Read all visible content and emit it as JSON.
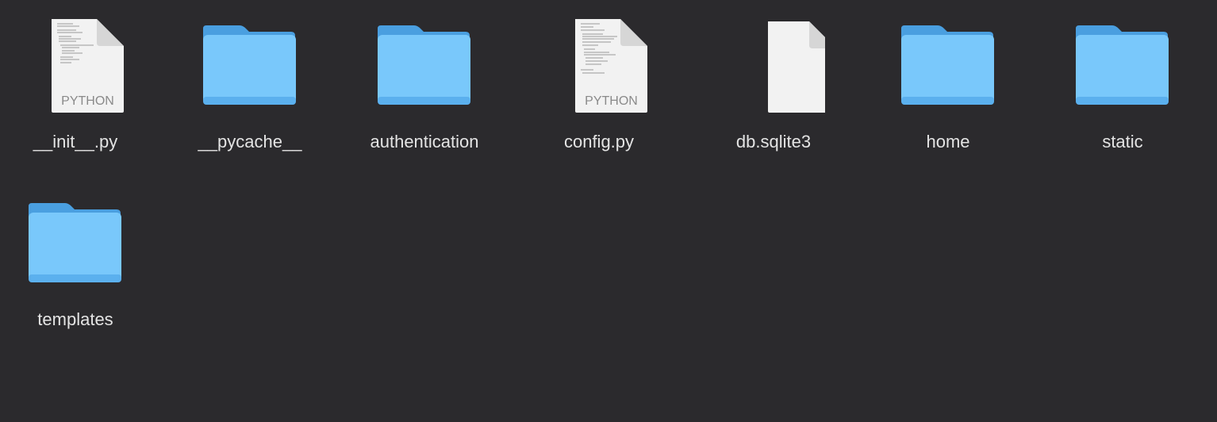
{
  "finder": {
    "items": [
      {
        "name": "__init__.py",
        "kind": "python-file",
        "badge": "PYTHON",
        "icon": "python-file-icon"
      },
      {
        "name": "__pycache__",
        "kind": "folder",
        "icon": "folder-icon"
      },
      {
        "name": "authentication",
        "kind": "folder",
        "icon": "folder-icon"
      },
      {
        "name": "config.py",
        "kind": "python-file",
        "badge": "PYTHON",
        "icon": "python-file-icon"
      },
      {
        "name": "db.sqlite3",
        "kind": "blank-file",
        "icon": "document-icon"
      },
      {
        "name": "home",
        "kind": "folder",
        "icon": "folder-icon"
      },
      {
        "name": "static",
        "kind": "folder",
        "icon": "folder-icon"
      },
      {
        "name": "templates",
        "kind": "folder",
        "icon": "folder-icon"
      }
    ]
  },
  "colors": {
    "background": "#2b2a2d",
    "folder_back": "#4a9fe0",
    "folder_front": "#79c8fb",
    "label": "#e4e4e4"
  }
}
